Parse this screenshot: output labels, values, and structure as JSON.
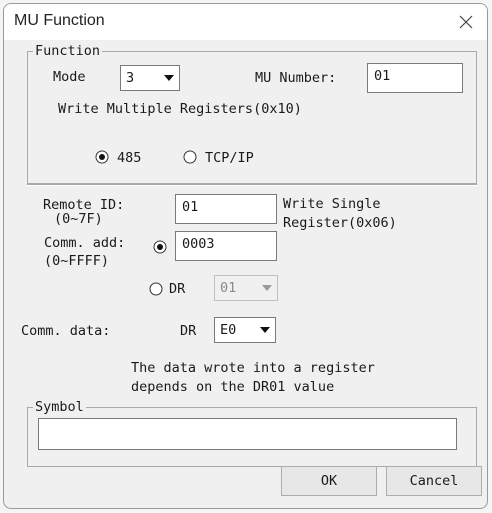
{
  "window": {
    "title": "MU Function",
    "close_icon": "close-icon"
  },
  "function_group": {
    "legend": "Function",
    "mode_label": "Mode",
    "mode_value": "3",
    "mu_number_label": "MU Number:",
    "mu_number_value": "01",
    "description": "Write Multiple Registers(0x10)",
    "radio_485": "485",
    "radio_tcpip": "TCP/IP",
    "selected_protocol": "485"
  },
  "remote": {
    "remote_id_label": "Remote ID:",
    "remote_id_range": "(0~7F)",
    "remote_id_value": "01",
    "write_single_line1": "Write Single",
    "write_single_line2": "Register(0x06)",
    "comm_add_label": "Comm. add:",
    "comm_add_range": "(0~FFFF)",
    "comm_add_value": "0003",
    "dr_label": "DR",
    "dr_value": "01",
    "selected_address_mode": "direct"
  },
  "comm_data": {
    "label": "Comm. data:",
    "dr_label": "DR",
    "dr_value": "E0",
    "note_line1": "The data wrote into a register",
    "note_line2": "depends on the DR01 value"
  },
  "symbol": {
    "legend": "Symbol",
    "value": ""
  },
  "buttons": {
    "ok": "OK",
    "cancel": "Cancel"
  }
}
